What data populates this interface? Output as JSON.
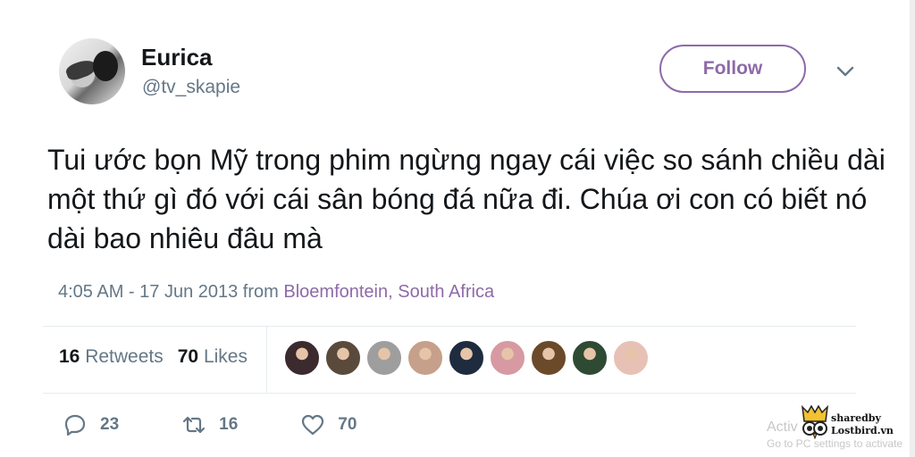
{
  "tweet": {
    "author_name": "Eurica",
    "author_handle": "@tv_skapie",
    "follow_label": "Follow",
    "text": "Tui ước bọn Mỹ trong phim ngừng ngay cái việc so sánh chiều dài một thứ gì đó với cái sân bóng đá nữa đi. Chúa ơi con có biết nó dài bao nhiêu đâu mà",
    "timestamp": "4:05 AM - 17 Jun 2013 from",
    "location": "Bloemfontein, South Africa",
    "retweets_count": "16",
    "retweets_label": "Retweets",
    "likes_count": "70",
    "likes_label": "Likes",
    "likers": [
      {
        "color": "#3b2a2e"
      },
      {
        "color": "#5a4a3c"
      },
      {
        "color": "#9e9e9e"
      },
      {
        "color": "#c6a08a"
      },
      {
        "color": "#1f2b3f"
      },
      {
        "color": "#d79aa2"
      },
      {
        "color": "#6b4a2a"
      },
      {
        "color": "#2f4a33"
      },
      {
        "color": "#e8c1b6"
      }
    ],
    "actions": {
      "reply_count": "23",
      "retweet_count": "16",
      "like_count": "70"
    }
  },
  "overlay": {
    "activate_text": "Activ",
    "activate_sub": "Go to PC settings to activate",
    "logo_line1": "sharedby",
    "logo_line2": "Lostbird.vn"
  },
  "colors": {
    "accent": "#8e6aa8",
    "muted": "#657786",
    "text": "#14171a",
    "divider": "#e6ecf0"
  },
  "icons": [
    "chevron-down-icon",
    "reply-icon",
    "retweet-icon",
    "heart-icon"
  ]
}
